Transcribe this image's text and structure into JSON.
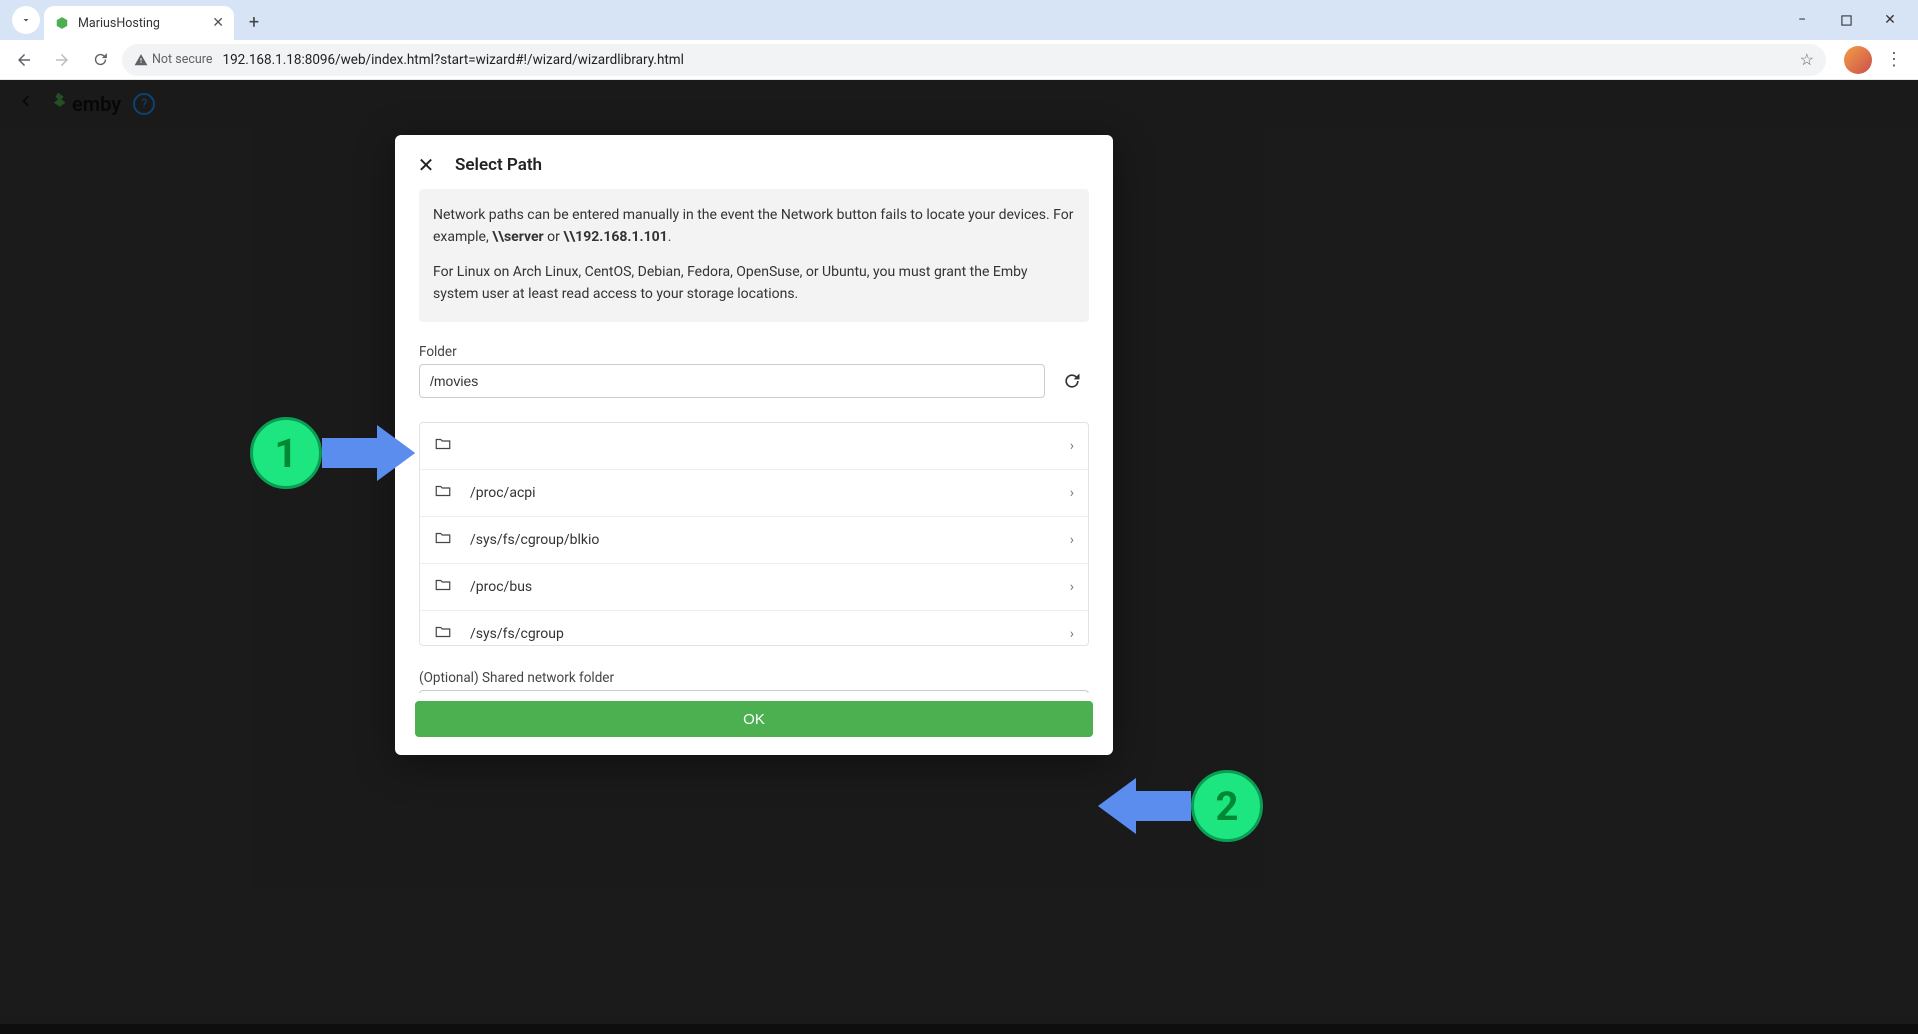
{
  "browser": {
    "tab_title": "MariusHosting",
    "url": "192.168.1.18:8096/web/index.html?start=wizard#!/wizard/wizardlibrary.html",
    "secure_label": "Not secure"
  },
  "emby": {
    "brand": "emby"
  },
  "dialog": {
    "title": "Select Path",
    "info_p1_a": "Network paths can be entered manually in the event the Network button fails to locate your devices. For example, ",
    "info_p1_b": "\\\\server",
    "info_p1_c": " or ",
    "info_p1_d": "\\\\192.168.1.101",
    "info_p1_e": ".",
    "info_p2": "For Linux on Arch Linux, CentOS, Debian, Fedora, OpenSuse, or Ubuntu, you must grant the Emby system user at least read access to your storage locations.",
    "folder_label": "Folder",
    "folder_value": "/movies",
    "folders": [
      {
        "path": ""
      },
      {
        "path": "/proc/acpi"
      },
      {
        "path": "/sys/fs/cgroup/blkio"
      },
      {
        "path": "/proc/bus"
      },
      {
        "path": "/sys/fs/cgroup"
      }
    ],
    "optional_label": "(Optional) Shared network folder",
    "ok_label": "OK"
  },
  "annotations": {
    "badge1": "1",
    "badge2": "2"
  }
}
